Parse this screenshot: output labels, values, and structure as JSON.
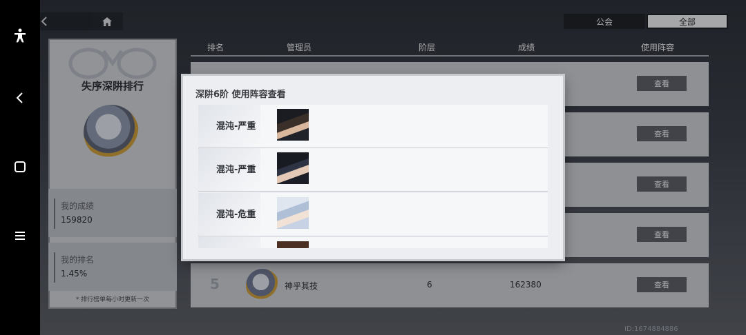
{
  "system_nav": {
    "accessibility_icon": "accessibility-icon",
    "back_icon": "back-icon",
    "home_icon": "square-home-icon",
    "menu_icon": "menu-icon"
  },
  "topbar": {
    "back_icon": "chevron-left-icon",
    "home_icon": "house-icon",
    "tabs": [
      {
        "label": "公会",
        "active": false
      },
      {
        "label": "全部",
        "active": true
      }
    ]
  },
  "left_panel": {
    "title": "失序深阱排行",
    "my_score_label": "我的成绩",
    "my_score_value": "159820",
    "my_rank_label": "我的排名",
    "my_rank_value": "1.45%",
    "footnote": "* 排行榜单每小时更新一次"
  },
  "table": {
    "headers": [
      "排名",
      "管理员",
      "阶层",
      "成绩",
      "使用阵容"
    ],
    "view_label": "查看",
    "rows": [
      {
        "rank": "",
        "name": "",
        "floor": "",
        "score": "",
        "view": "查看"
      },
      {
        "rank": "",
        "name": "",
        "floor": "",
        "score": "",
        "view": "查看"
      },
      {
        "rank": "",
        "name": "",
        "floor": "",
        "score": "",
        "view": "查看"
      },
      {
        "rank": "",
        "name": "",
        "floor": "",
        "score": "",
        "view": "查看"
      },
      {
        "rank": "5",
        "name": "神乎其技",
        "floor": "6",
        "score": "162380",
        "view": "查看"
      }
    ]
  },
  "uid": "ID:1674884886",
  "modal": {
    "title": "深阱6阶 使用阵容查看",
    "entries": [
      {
        "label": "混沌-严重"
      },
      {
        "label": "混沌-严重"
      },
      {
        "label": "混沌-危重"
      },
      {
        "label": ""
      }
    ]
  },
  "colors": {
    "panel": "#c5c8cd",
    "button": "#5a5e66",
    "modal": "#eceef1"
  }
}
